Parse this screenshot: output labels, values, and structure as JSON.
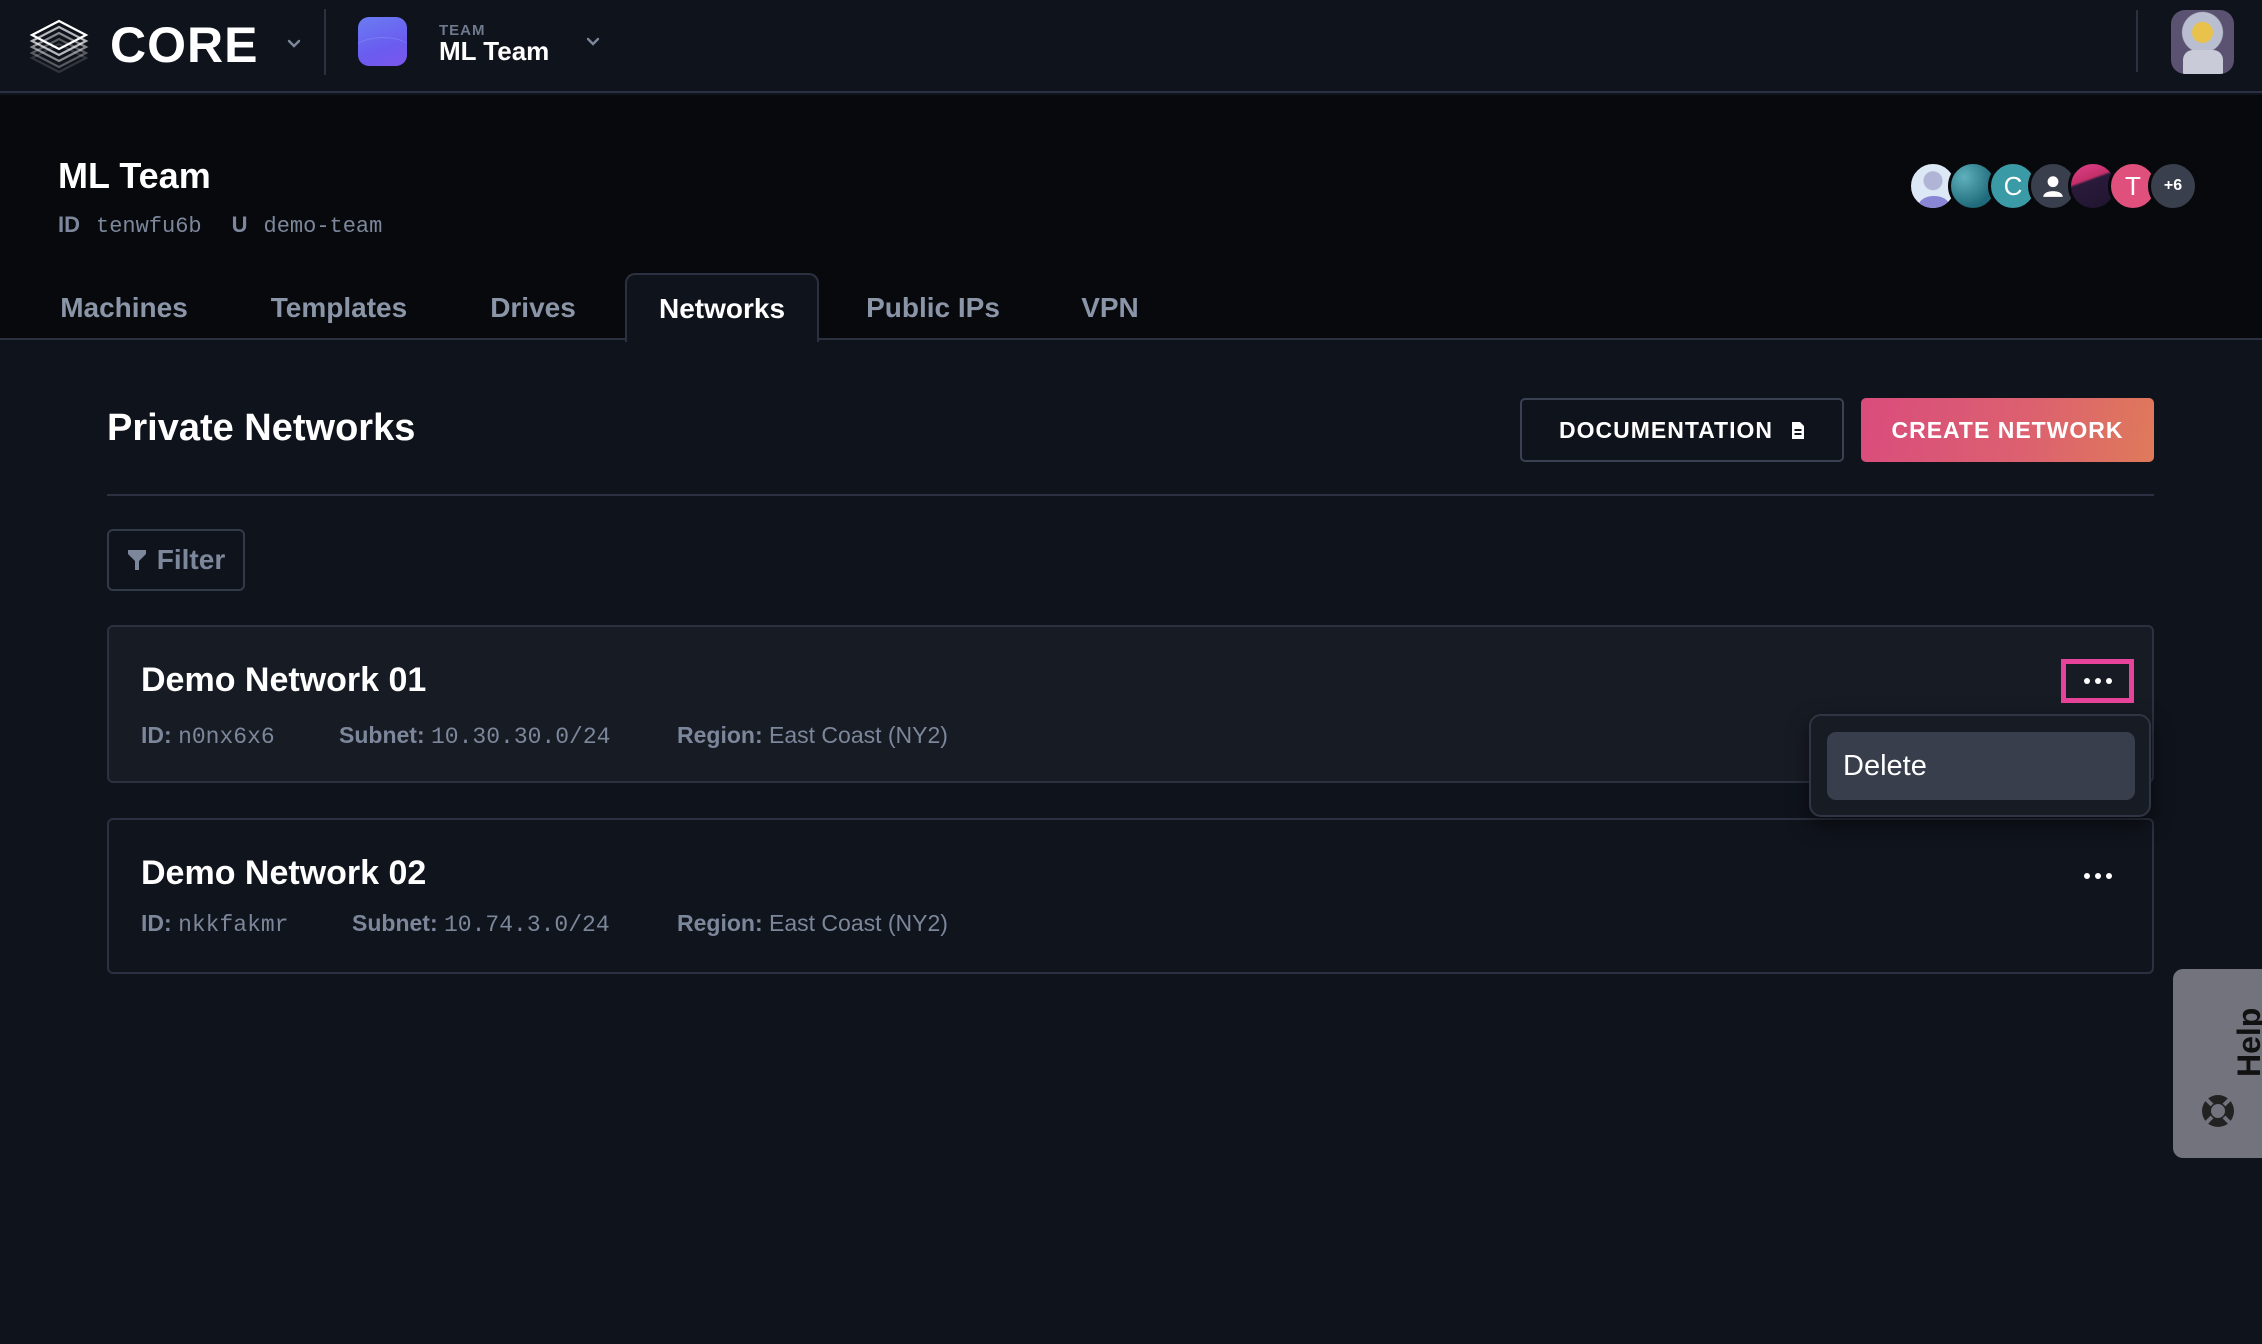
{
  "topbar": {
    "brand": "CORE",
    "team_label": "TEAM",
    "team_name": "ML Team",
    "icons": {
      "logo": "stacked-layers-logo",
      "brand_chevron": "chevron-down-icon",
      "team_chevron": "chevron-down-icon",
      "user_avatar": "astronaut-avatar"
    }
  },
  "team_header": {
    "title": "ML Team",
    "id_label": "ID",
    "id_value": "tenwfu6b",
    "u_label": "U",
    "u_value": "demo-team",
    "members": [
      {
        "type": "photo",
        "color": "#c9d6ee"
      },
      {
        "type": "photo",
        "color": "#2f8a9a"
      },
      {
        "type": "initial",
        "text": "C",
        "color": "#3a9aa6"
      },
      {
        "type": "placeholder",
        "color": "#3a3f4d"
      },
      {
        "type": "photo",
        "color": "#6e2a5a"
      },
      {
        "type": "initial",
        "text": "T",
        "color": "#e0507c"
      },
      {
        "type": "count",
        "text": "+6",
        "color": "#3a3f4d"
      }
    ]
  },
  "tabs": [
    {
      "label": "Machines",
      "active": false
    },
    {
      "label": "Templates",
      "active": false
    },
    {
      "label": "Drives",
      "active": false
    },
    {
      "label": "Networks",
      "active": true
    },
    {
      "label": "Public IPs",
      "active": false
    },
    {
      "label": "VPN",
      "active": false
    }
  ],
  "main": {
    "title": "Private Networks",
    "documentation_label": "DOCUMENTATION",
    "create_label": "CREATE NETWORK",
    "filter_label": "Filter",
    "accent_color": "#d94c7c",
    "focus_color": "#e8439a"
  },
  "networks": [
    {
      "name": "Demo Network 01",
      "id_label": "ID:",
      "id": "n0nx6x6",
      "subnet_label": "Subnet:",
      "subnet": "10.30.30.0/24",
      "region_label": "Region:",
      "region": "East Coast (NY2)"
    },
    {
      "name": "Demo Network 02",
      "id_label": "ID:",
      "id": "nkkfakmr",
      "subnet_label": "Subnet:",
      "subnet": "10.74.3.0/24",
      "region_label": "Region:",
      "region": "East Coast (NY2)"
    }
  ],
  "context_menu": {
    "items": [
      {
        "label": "Delete"
      }
    ]
  },
  "help": {
    "label": "Help",
    "icon": "lifebuoy-icon"
  }
}
